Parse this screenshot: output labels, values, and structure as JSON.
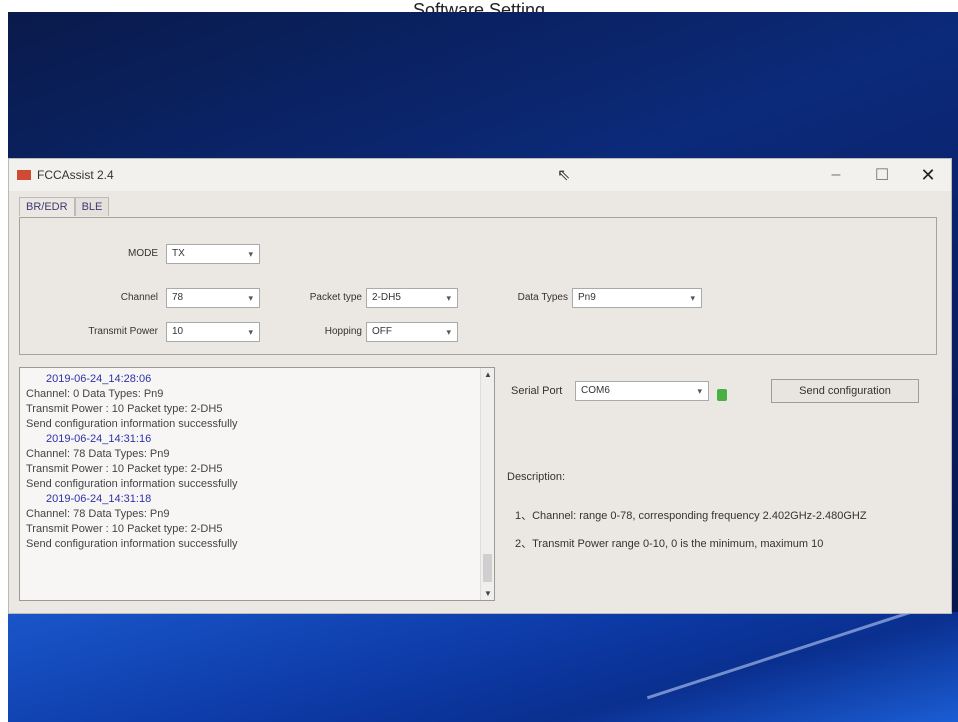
{
  "caption": "Software Setting",
  "window": {
    "title": "FCCAssist 2.4",
    "controls": {
      "minimize": "–",
      "maximize": "☐",
      "close": "✕"
    }
  },
  "tabs": [
    "BR/EDR",
    "BLE"
  ],
  "config": {
    "mode": {
      "label": "MODE",
      "value": "TX"
    },
    "channel": {
      "label": "Channel",
      "value": "78"
    },
    "transmit_power": {
      "label": "Transmit Power",
      "value": "10"
    },
    "packet_type": {
      "label": "Packet type",
      "value": "2-DH5"
    },
    "hopping": {
      "label": "Hopping",
      "value": "OFF"
    },
    "data_types": {
      "label": "Data Types",
      "value": "Pn9"
    }
  },
  "log": [
    {
      "kind": "ts",
      "text": "2019-06-24_14:28:06"
    },
    {
      "kind": "line",
      "text": "Channel: 0          Data Types: Pn9"
    },
    {
      "kind": "line",
      "text": "Transmit Power : 10     Packet type: 2-DH5"
    },
    {
      "kind": "line",
      "text": "Send configuration information successfully"
    },
    {
      "kind": "ts",
      "text": "2019-06-24_14:31:16"
    },
    {
      "kind": "line",
      "text": "Channel: 78          Data Types: Pn9"
    },
    {
      "kind": "line",
      "text": "Transmit Power : 10     Packet type: 2-DH5"
    },
    {
      "kind": "line",
      "text": "Send configuration information successfully"
    },
    {
      "kind": "ts",
      "text": "2019-06-24_14:31:18"
    },
    {
      "kind": "line",
      "text": "Channel: 78          Data Types: Pn9"
    },
    {
      "kind": "line",
      "text": "Transmit Power : 10     Packet type: 2-DH5"
    },
    {
      "kind": "line",
      "text": "Send configuration information successfully"
    }
  ],
  "serial": {
    "label": "Serial Port",
    "value": "COM6"
  },
  "send_button": "Send configuration",
  "description": {
    "title": "Description:",
    "items": [
      "1、Channel: range 0-78, corresponding frequency 2.402GHz-2.480GHZ",
      "2、Transmit Power  range 0-10, 0 is the minimum, maximum 10"
    ]
  },
  "icons": {
    "dropdown": "▾",
    "scroll_up": "▲",
    "scroll_down": "▼",
    "cursor": "⇖"
  },
  "colors": {
    "timestamp": "#2d33a8",
    "status_led": "#4bb043",
    "app_icon": "#d04b34"
  }
}
